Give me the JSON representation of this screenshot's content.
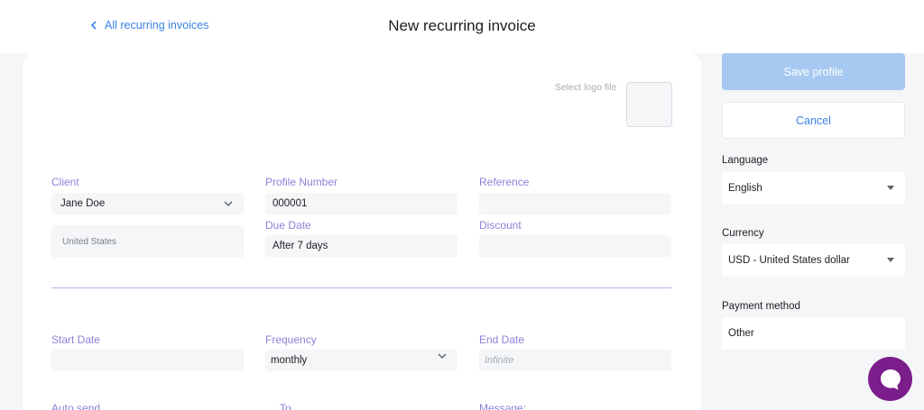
{
  "header": {
    "back_label": "All recurring invoices",
    "title": "New recurring invoice"
  },
  "logo": {
    "select_label": "Select logo file"
  },
  "fields": {
    "client": {
      "label": "Client",
      "value": "Jane Doe",
      "address": "United States"
    },
    "profile_number": {
      "label": "Profile Number",
      "value": "000001"
    },
    "reference": {
      "label": "Reference",
      "value": ""
    },
    "due_date": {
      "label": "Due Date",
      "value": "After 7 days"
    },
    "discount": {
      "label": "Discount",
      "value": ""
    },
    "start_date": {
      "label": "Start Date",
      "value": ""
    },
    "frequency": {
      "label": "Frequency",
      "value": "monthly"
    },
    "end_date": {
      "label": "End Date",
      "placeholder": "Infinite"
    },
    "auto_send": {
      "label": "Auto send"
    },
    "to": {
      "label": "To"
    },
    "message": {
      "label": "Message:"
    }
  },
  "sidebar": {
    "save_label": "Save profile",
    "cancel_label": "Cancel",
    "language": {
      "label": "Language",
      "value": "English"
    },
    "currency": {
      "label": "Currency",
      "value": "USD - United States dollar"
    },
    "payment_method": {
      "label": "Payment method",
      "value": "Other"
    }
  },
  "colors": {
    "accent": "#3b82e6",
    "label_purple": "#8b82d8",
    "save_disabled": "#a7c9f1",
    "chat": "#7b1d8a"
  },
  "icons": {
    "back": "chevron-left-icon",
    "dropdown": "chevron-down-icon",
    "select_caret": "caret-down-icon",
    "chat": "chat-icon"
  }
}
